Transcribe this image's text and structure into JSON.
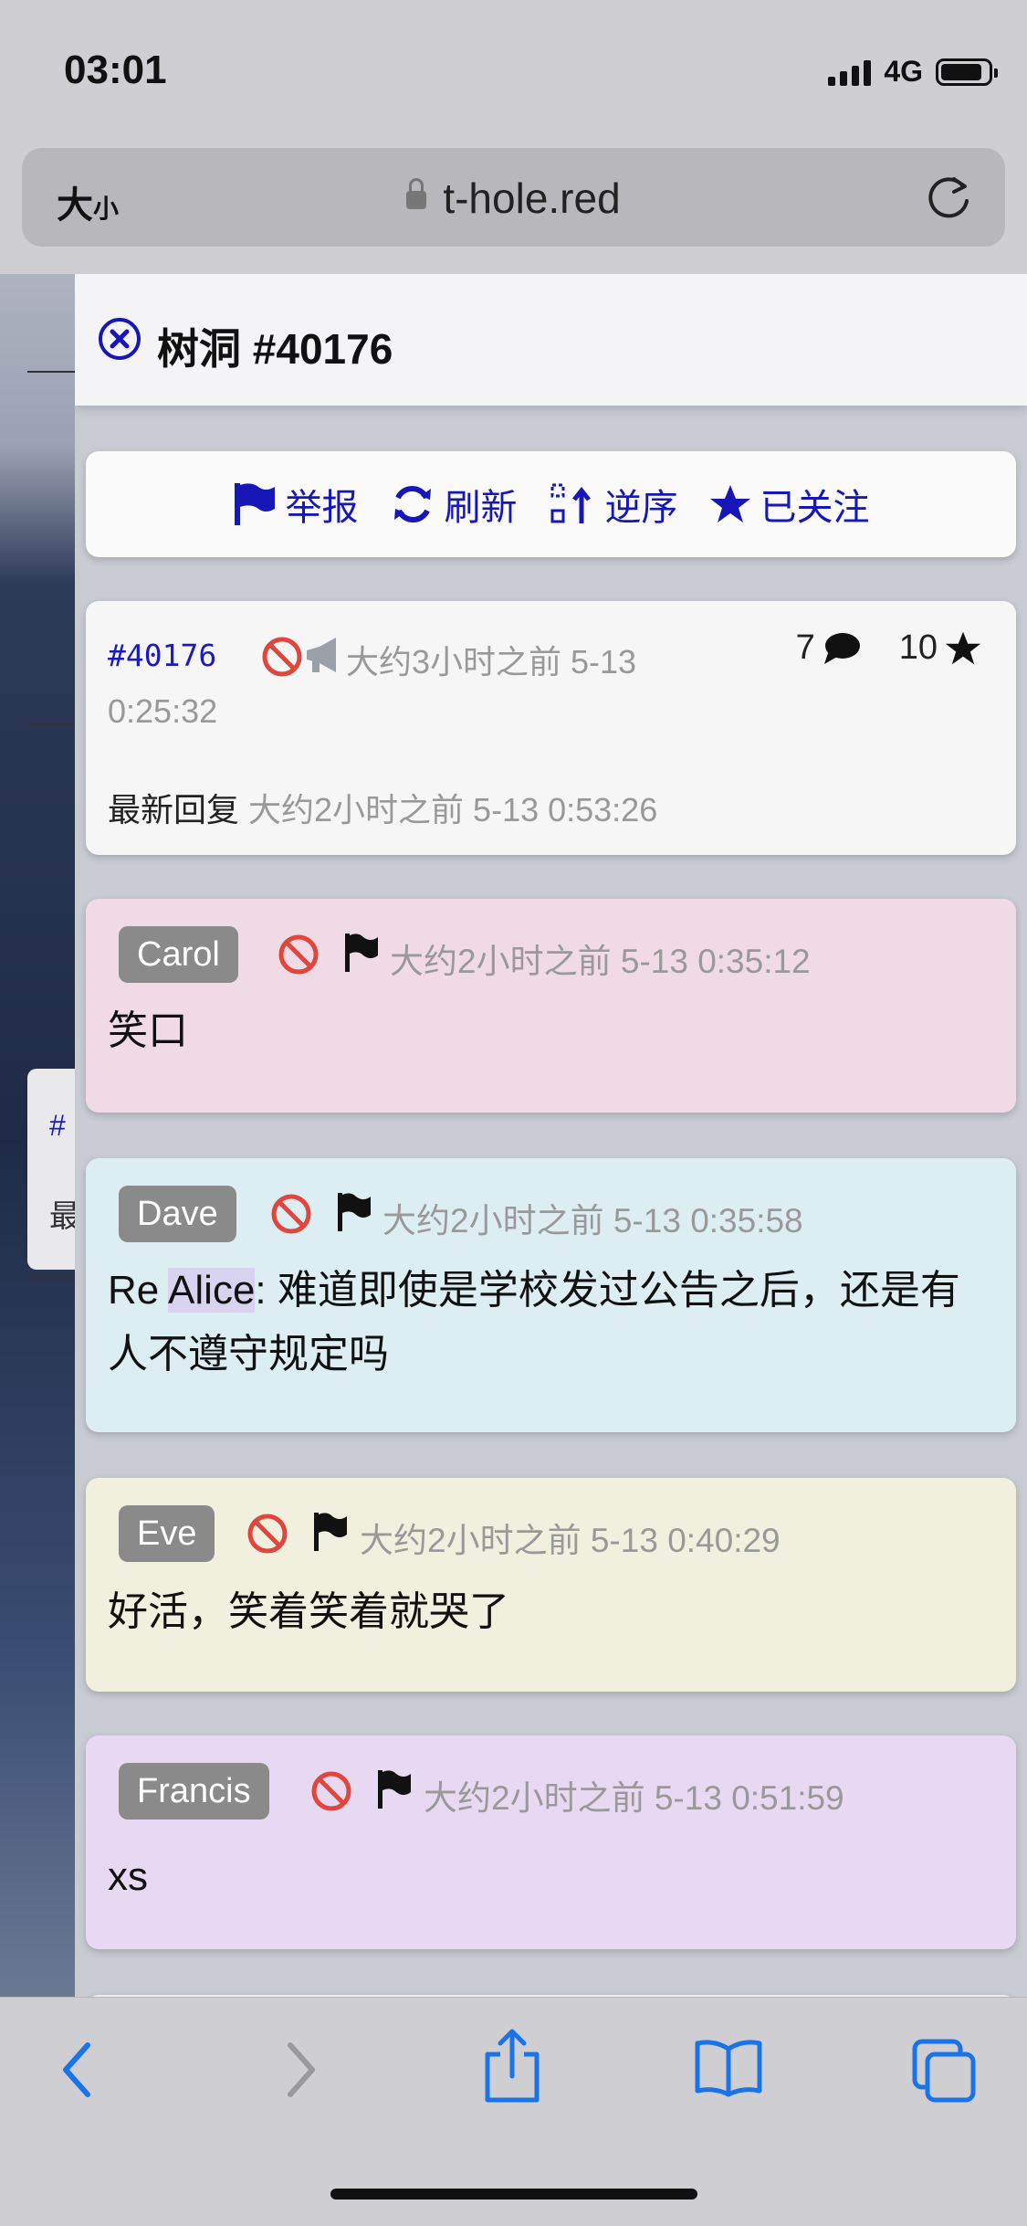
{
  "status": {
    "time": "03:01",
    "network": "4G"
  },
  "browser": {
    "text_size_label": "大",
    "text_size_small": "小",
    "url": "t-hole.red"
  },
  "panel": {
    "title": "树洞 #40176",
    "toolbar": {
      "report": "举报",
      "refresh": "刷新",
      "reverse": "逆序",
      "following": "已关注"
    }
  },
  "post": {
    "id": "#40176",
    "time_line1": "大约3小时之前 5-13",
    "time_line2": "0:25:32",
    "reply_count": "7",
    "star_count": "10",
    "latest_label": "最新回复",
    "latest_time": "大约2小时之前 5-13 0:53:26"
  },
  "replies": [
    {
      "name": "Carol",
      "time": "大约2小时之前 5-13 0:35:12",
      "text": "笑口",
      "color": "#f0dae6"
    },
    {
      "name": "Dave",
      "time": "大约2小时之前 5-13 0:35:58",
      "re_prefix": "Re ",
      "mention": "Alice",
      "text": ": 难道即使是学校发过公告之后，还是有人不遵守规定吗",
      "color": "#ddeef3"
    },
    {
      "name": "Eve",
      "time": "大约2小时之前 5-13 0:40:29",
      "text": "好活，笑着笑着就哭了",
      "color": "#f1efdd"
    },
    {
      "name": "Francis",
      "time": "大约2小时之前 5-13 0:51:59",
      "text": "xs",
      "color": "#e6d9f1"
    }
  ],
  "background_page": {
    "peek_id": "#",
    "peek_text": "最"
  },
  "colors": {
    "accent": "#1717b8",
    "muted": "#999999"
  },
  "icons": [
    "close-circle-icon",
    "flag-icon",
    "refresh-icon",
    "sort-icon",
    "star-icon",
    "ban-icon",
    "megaphone-icon",
    "comment-icon",
    "back-icon",
    "forward-icon",
    "share-icon",
    "bookmarks-icon",
    "tabs-icon"
  ]
}
